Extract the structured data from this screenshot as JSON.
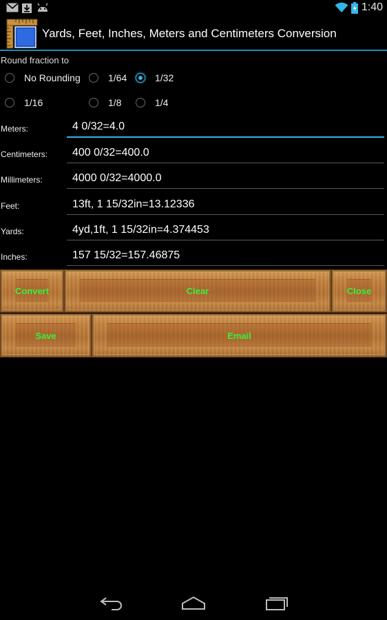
{
  "status_bar": {
    "time": "1:40",
    "icons": [
      "gmail-icon",
      "download-icon",
      "android-icon",
      "wifi-icon",
      "battery-icon"
    ]
  },
  "action_bar": {
    "title": "Yards, Feet, Inches, Meters and Centimeters Conversion",
    "icon": "app-ruler-icon"
  },
  "rounding": {
    "label": "Round fraction to",
    "options": [
      {
        "label": "No Rounding",
        "checked": false
      },
      {
        "label": "1/64",
        "checked": false
      },
      {
        "label": "1/32",
        "checked": true
      },
      {
        "label": "1/16",
        "checked": false
      },
      {
        "label": "1/8",
        "checked": false
      },
      {
        "label": "1/4",
        "checked": false
      }
    ]
  },
  "fields": [
    {
      "label": "Meters:",
      "value": "4 0/32=4.0"
    },
    {
      "label": "Centimeters:",
      "value": "400 0/32=400.0"
    },
    {
      "label": "Millimeters:",
      "value": "4000 0/32=4000.0"
    },
    {
      "label": "Feet:",
      "value": "13ft, 1 15/32in=13.12336"
    },
    {
      "label": "Yards:",
      "value": "4yd,1ft, 1 15/32in=4.374453"
    },
    {
      "label": "Inches:",
      "value": "157 15/32=157.46875"
    }
  ],
  "buttons": {
    "convert": "Convert",
    "clear": "Clear",
    "close": "Close",
    "save": "Save",
    "email": "Email"
  },
  "colors": {
    "accent": "#33b5e5",
    "button_text": "#3cf03c",
    "wood": "#b27234"
  },
  "nav_bar": {
    "icons": [
      "back-icon",
      "home-icon",
      "recent-apps-icon"
    ]
  }
}
